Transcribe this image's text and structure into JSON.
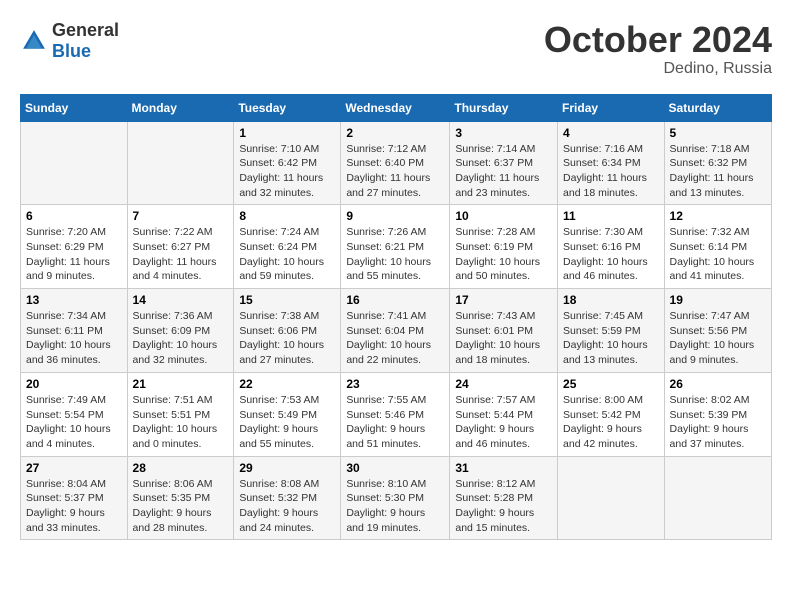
{
  "logo": {
    "general": "General",
    "blue": "Blue"
  },
  "header": {
    "month": "October 2024",
    "location": "Dedino, Russia"
  },
  "weekdays": [
    "Sunday",
    "Monday",
    "Tuesday",
    "Wednesday",
    "Thursday",
    "Friday",
    "Saturday"
  ],
  "weeks": [
    [
      {
        "day": "",
        "sunrise": "",
        "sunset": "",
        "daylight": ""
      },
      {
        "day": "",
        "sunrise": "",
        "sunset": "",
        "daylight": ""
      },
      {
        "day": "1",
        "sunrise": "Sunrise: 7:10 AM",
        "sunset": "Sunset: 6:42 PM",
        "daylight": "Daylight: 11 hours and 32 minutes."
      },
      {
        "day": "2",
        "sunrise": "Sunrise: 7:12 AM",
        "sunset": "Sunset: 6:40 PM",
        "daylight": "Daylight: 11 hours and 27 minutes."
      },
      {
        "day": "3",
        "sunrise": "Sunrise: 7:14 AM",
        "sunset": "Sunset: 6:37 PM",
        "daylight": "Daylight: 11 hours and 23 minutes."
      },
      {
        "day": "4",
        "sunrise": "Sunrise: 7:16 AM",
        "sunset": "Sunset: 6:34 PM",
        "daylight": "Daylight: 11 hours and 18 minutes."
      },
      {
        "day": "5",
        "sunrise": "Sunrise: 7:18 AM",
        "sunset": "Sunset: 6:32 PM",
        "daylight": "Daylight: 11 hours and 13 minutes."
      }
    ],
    [
      {
        "day": "6",
        "sunrise": "Sunrise: 7:20 AM",
        "sunset": "Sunset: 6:29 PM",
        "daylight": "Daylight: 11 hours and 9 minutes."
      },
      {
        "day": "7",
        "sunrise": "Sunrise: 7:22 AM",
        "sunset": "Sunset: 6:27 PM",
        "daylight": "Daylight: 11 hours and 4 minutes."
      },
      {
        "day": "8",
        "sunrise": "Sunrise: 7:24 AM",
        "sunset": "Sunset: 6:24 PM",
        "daylight": "Daylight: 10 hours and 59 minutes."
      },
      {
        "day": "9",
        "sunrise": "Sunrise: 7:26 AM",
        "sunset": "Sunset: 6:21 PM",
        "daylight": "Daylight: 10 hours and 55 minutes."
      },
      {
        "day": "10",
        "sunrise": "Sunrise: 7:28 AM",
        "sunset": "Sunset: 6:19 PM",
        "daylight": "Daylight: 10 hours and 50 minutes."
      },
      {
        "day": "11",
        "sunrise": "Sunrise: 7:30 AM",
        "sunset": "Sunset: 6:16 PM",
        "daylight": "Daylight: 10 hours and 46 minutes."
      },
      {
        "day": "12",
        "sunrise": "Sunrise: 7:32 AM",
        "sunset": "Sunset: 6:14 PM",
        "daylight": "Daylight: 10 hours and 41 minutes."
      }
    ],
    [
      {
        "day": "13",
        "sunrise": "Sunrise: 7:34 AM",
        "sunset": "Sunset: 6:11 PM",
        "daylight": "Daylight: 10 hours and 36 minutes."
      },
      {
        "day": "14",
        "sunrise": "Sunrise: 7:36 AM",
        "sunset": "Sunset: 6:09 PM",
        "daylight": "Daylight: 10 hours and 32 minutes."
      },
      {
        "day": "15",
        "sunrise": "Sunrise: 7:38 AM",
        "sunset": "Sunset: 6:06 PM",
        "daylight": "Daylight: 10 hours and 27 minutes."
      },
      {
        "day": "16",
        "sunrise": "Sunrise: 7:41 AM",
        "sunset": "Sunset: 6:04 PM",
        "daylight": "Daylight: 10 hours and 22 minutes."
      },
      {
        "day": "17",
        "sunrise": "Sunrise: 7:43 AM",
        "sunset": "Sunset: 6:01 PM",
        "daylight": "Daylight: 10 hours and 18 minutes."
      },
      {
        "day": "18",
        "sunrise": "Sunrise: 7:45 AM",
        "sunset": "Sunset: 5:59 PM",
        "daylight": "Daylight: 10 hours and 13 minutes."
      },
      {
        "day": "19",
        "sunrise": "Sunrise: 7:47 AM",
        "sunset": "Sunset: 5:56 PM",
        "daylight": "Daylight: 10 hours and 9 minutes."
      }
    ],
    [
      {
        "day": "20",
        "sunrise": "Sunrise: 7:49 AM",
        "sunset": "Sunset: 5:54 PM",
        "daylight": "Daylight: 10 hours and 4 minutes."
      },
      {
        "day": "21",
        "sunrise": "Sunrise: 7:51 AM",
        "sunset": "Sunset: 5:51 PM",
        "daylight": "Daylight: 10 hours and 0 minutes."
      },
      {
        "day": "22",
        "sunrise": "Sunrise: 7:53 AM",
        "sunset": "Sunset: 5:49 PM",
        "daylight": "Daylight: 9 hours and 55 minutes."
      },
      {
        "day": "23",
        "sunrise": "Sunrise: 7:55 AM",
        "sunset": "Sunset: 5:46 PM",
        "daylight": "Daylight: 9 hours and 51 minutes."
      },
      {
        "day": "24",
        "sunrise": "Sunrise: 7:57 AM",
        "sunset": "Sunset: 5:44 PM",
        "daylight": "Daylight: 9 hours and 46 minutes."
      },
      {
        "day": "25",
        "sunrise": "Sunrise: 8:00 AM",
        "sunset": "Sunset: 5:42 PM",
        "daylight": "Daylight: 9 hours and 42 minutes."
      },
      {
        "day": "26",
        "sunrise": "Sunrise: 8:02 AM",
        "sunset": "Sunset: 5:39 PM",
        "daylight": "Daylight: 9 hours and 37 minutes."
      }
    ],
    [
      {
        "day": "27",
        "sunrise": "Sunrise: 8:04 AM",
        "sunset": "Sunset: 5:37 PM",
        "daylight": "Daylight: 9 hours and 33 minutes."
      },
      {
        "day": "28",
        "sunrise": "Sunrise: 8:06 AM",
        "sunset": "Sunset: 5:35 PM",
        "daylight": "Daylight: 9 hours and 28 minutes."
      },
      {
        "day": "29",
        "sunrise": "Sunrise: 8:08 AM",
        "sunset": "Sunset: 5:32 PM",
        "daylight": "Daylight: 9 hours and 24 minutes."
      },
      {
        "day": "30",
        "sunrise": "Sunrise: 8:10 AM",
        "sunset": "Sunset: 5:30 PM",
        "daylight": "Daylight: 9 hours and 19 minutes."
      },
      {
        "day": "31",
        "sunrise": "Sunrise: 8:12 AM",
        "sunset": "Sunset: 5:28 PM",
        "daylight": "Daylight: 9 hours and 15 minutes."
      },
      {
        "day": "",
        "sunrise": "",
        "sunset": "",
        "daylight": ""
      },
      {
        "day": "",
        "sunrise": "",
        "sunset": "",
        "daylight": ""
      }
    ]
  ]
}
